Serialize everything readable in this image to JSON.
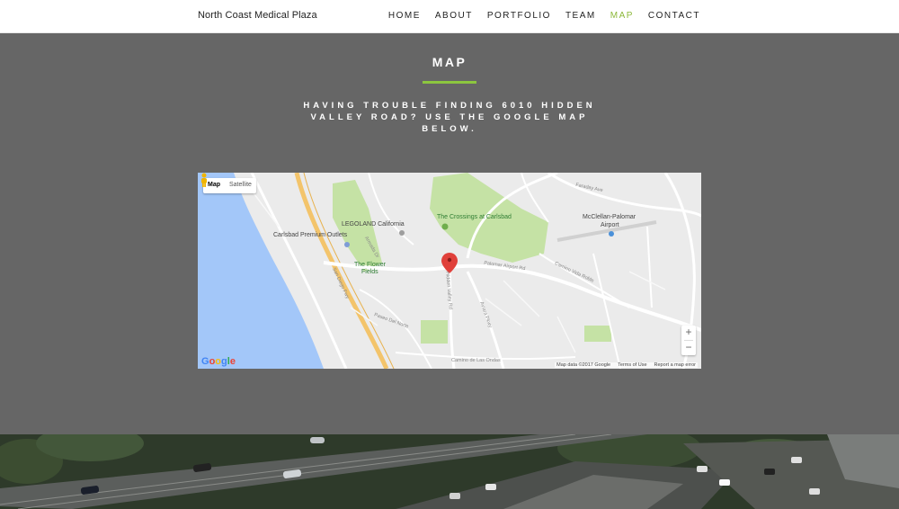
{
  "brand": "North Coast Medical Plaza",
  "nav": {
    "items": [
      {
        "label": "HOME",
        "active": false
      },
      {
        "label": "ABOUT",
        "active": false
      },
      {
        "label": "PORTFOLIO",
        "active": false
      },
      {
        "label": "TEAM",
        "active": false
      },
      {
        "label": "MAP",
        "active": true
      },
      {
        "label": "CONTACT",
        "active": false
      }
    ]
  },
  "section": {
    "title": "MAP",
    "subtitle": "HAVING TROUBLE FINDING 6010 HIDDEN VALLEY ROAD? USE THE GOOGLE MAP BELOW."
  },
  "map": {
    "type_map": "Map",
    "type_satellite": "Satellite",
    "zoom_in": "+",
    "zoom_out": "−",
    "logo": "Google",
    "data_credit": "Map data ©2017 Google",
    "terms": "Terms of Use",
    "report": "Report a map error",
    "places": {
      "legoland": "LEGOLAND California",
      "outlets": "Carlsbad Premium Outlets",
      "crossings": "The Crossings at Carlsbad",
      "airport_1": "McClellan-Palomar",
      "airport_2": "Airport",
      "flower_1": "The Flower",
      "flower_2": "Fields"
    },
    "roads": {
      "palomar": "Palomar Airport Rd",
      "faraday": "Faraday Ave",
      "camino": "Camino Vida Roble",
      "paseo": "Paseo Del Norte",
      "sandiego": "San Diego Fwy",
      "hidden": "Hidden Valley Rd",
      "lascolinas": "Camino de Las Ondas",
      "legoland_dr": "Armada Dr",
      "aviara": "Aviara Pkwy"
    },
    "colors": {
      "water": "#a3c7f9",
      "park": "#c5e2a5",
      "road": "#ffffff",
      "freeway": "#f3c46b",
      "pin": "#e0403a"
    }
  },
  "colors": {
    "accent": "#8cb83a",
    "section_bg": "#666666"
  }
}
